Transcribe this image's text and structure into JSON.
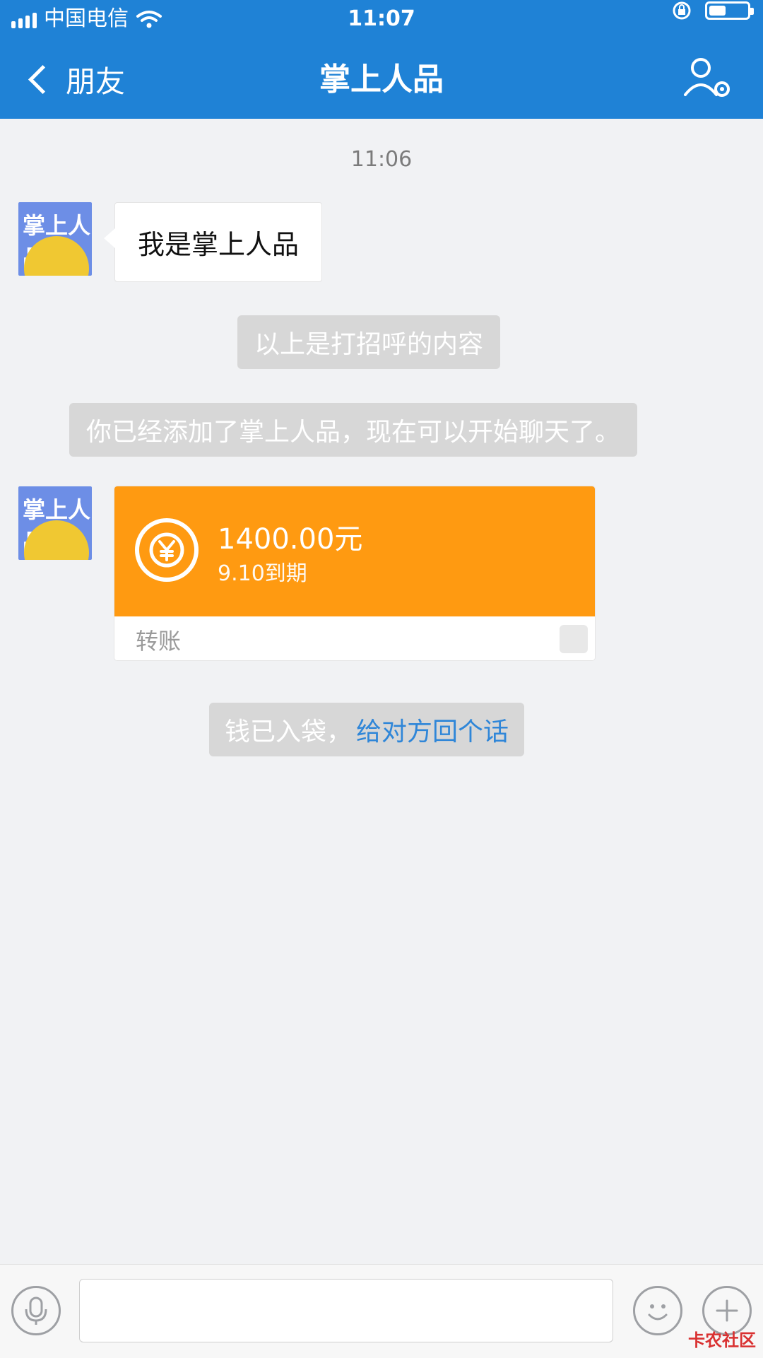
{
  "status": {
    "carrier": "中国电信",
    "time": "11:07"
  },
  "nav": {
    "back_label": "朋友",
    "title": "掌上人品"
  },
  "chat": {
    "timestamp": "11:06",
    "contact": {
      "avatar_text": "掌上人品"
    },
    "messages": {
      "greeting": "我是掌上人品",
      "system_greeting_note": "以上是打招呼的内容",
      "system_added_note": "你已经添加了掌上人品，现在可以开始聊天了。",
      "transfer": {
        "amount": "1400.00元",
        "due": "9.10到期",
        "label": "转账"
      },
      "received_note": "钱已入袋，",
      "reply_link": "给对方回个话"
    }
  },
  "input": {
    "value": ""
  },
  "watermark": "卡农社区",
  "colors": {
    "header": "#1f82d6",
    "transfer": "#ff9a11",
    "link": "#2f86d8",
    "system_pill": "#d7d7d7"
  }
}
